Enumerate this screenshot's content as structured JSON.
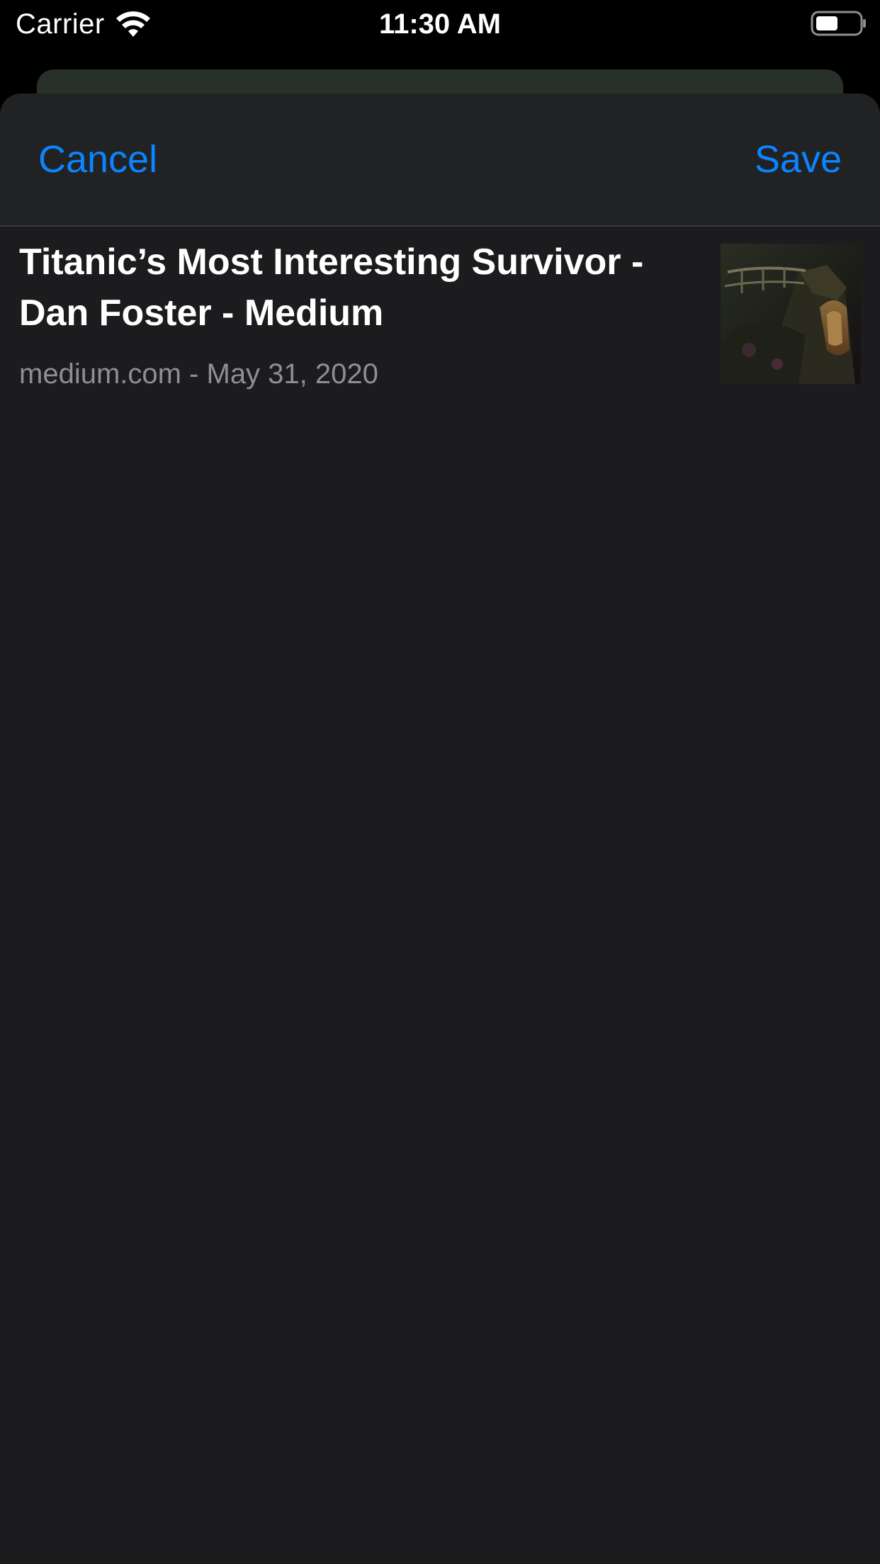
{
  "status_bar": {
    "carrier": "Carrier",
    "time": "11:30 AM"
  },
  "nav": {
    "cancel_label": "Cancel",
    "save_label": "Save",
    "accent_color": "#0a84ff"
  },
  "link": {
    "title": "Titanic’s Most Interesting Survivor - Dan Foster - Medium",
    "domain_date": "medium.com - May 31, 2020",
    "thumbnail_icon": "shipwreck-thumbnail"
  },
  "colors": {
    "sheet_background": "#1c1c1e",
    "secondary_text": "#8e8e93"
  }
}
